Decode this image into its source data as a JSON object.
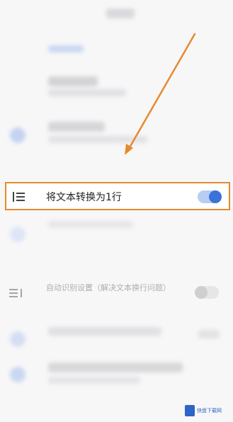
{
  "highlighted_setting": {
    "label": "将文本转换为1行",
    "icon": "list-lines-icon",
    "toggle_state": "on"
  },
  "dimmed_setting": {
    "label": "自动识别设置（解决文本换行问题）",
    "icon": "text-wrap-icon",
    "toggle_state": "off"
  },
  "annotation": {
    "arrow_color": "#e58a2e",
    "box_color": "#e58a2e"
  },
  "colors": {
    "toggle_on": "#3b72d8",
    "toggle_off": "#a9a9a9"
  },
  "watermark": {
    "text": "快盘下载网"
  }
}
